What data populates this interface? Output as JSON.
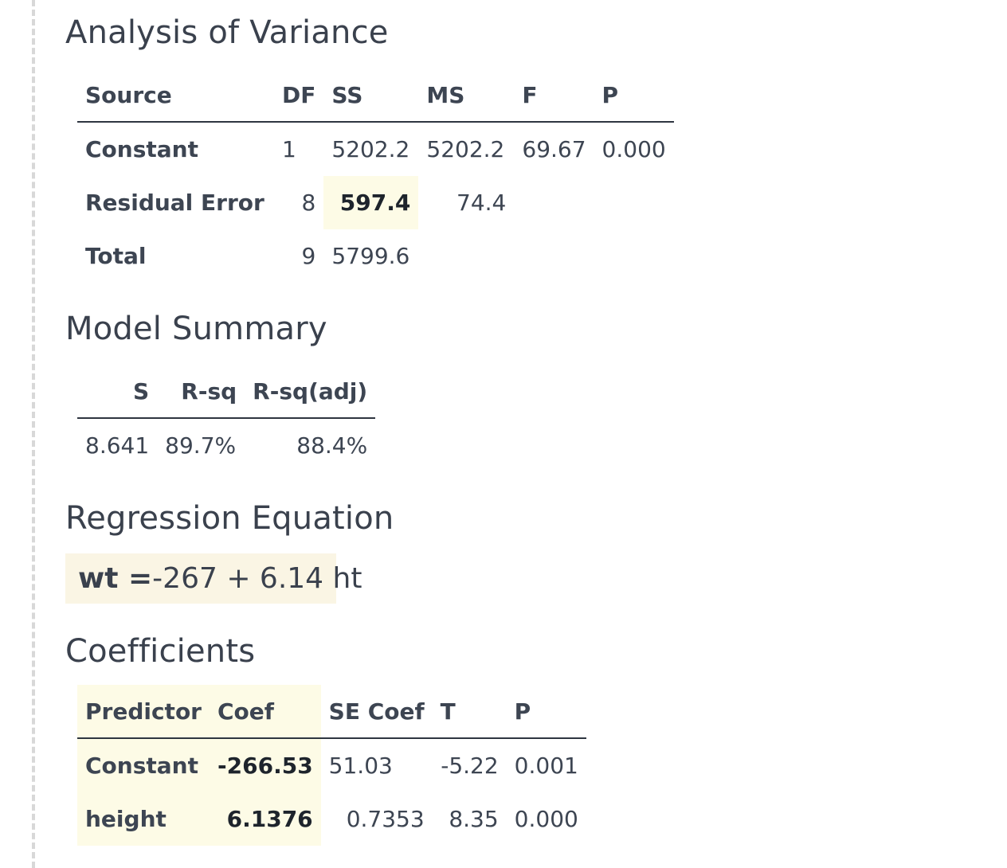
{
  "anova": {
    "title": "Analysis of Variance",
    "headers": [
      "Source",
      "DF",
      "SS",
      "MS",
      "F",
      "P"
    ],
    "rows": [
      {
        "source": "Constant",
        "df": "1",
        "ss": "5202.2",
        "ms": "5202.2",
        "f": "69.67",
        "p": "0.000"
      },
      {
        "source": "Residual Error",
        "df": "8",
        "ss": "597.4",
        "ms": "74.4",
        "f": "",
        "p": ""
      },
      {
        "source": "Total",
        "df": "9",
        "ss": "5799.6",
        "ms": "",
        "f": "",
        "p": ""
      }
    ]
  },
  "model_summary": {
    "title": "Model Summary",
    "headers": [
      "S",
      "R-sq",
      "R-sq(adj)"
    ],
    "row": {
      "s": "8.641",
      "rsq": "89.7%",
      "rsq_adj": "88.4%"
    }
  },
  "regression": {
    "title": "Regression Equation",
    "lhs": "wt =",
    "rhs": "-267 + 6.14 ht"
  },
  "coefficients": {
    "title": "Coefficients",
    "headers": [
      "Predictor",
      "Coef",
      "SE Coef",
      "T",
      "P"
    ],
    "rows": [
      {
        "predictor": "Constant",
        "coef": "-266.53",
        "se_coef": "51.03",
        "t": "-5.22",
        "p": "0.001"
      },
      {
        "predictor": "height",
        "coef": "6.1376",
        "se_coef": "0.7353",
        "t": "8.35",
        "p": "0.000"
      }
    ]
  },
  "colors": {
    "highlight": "#fdfbe6",
    "equation_background": "#faf5e4",
    "text": "#3d4552"
  }
}
